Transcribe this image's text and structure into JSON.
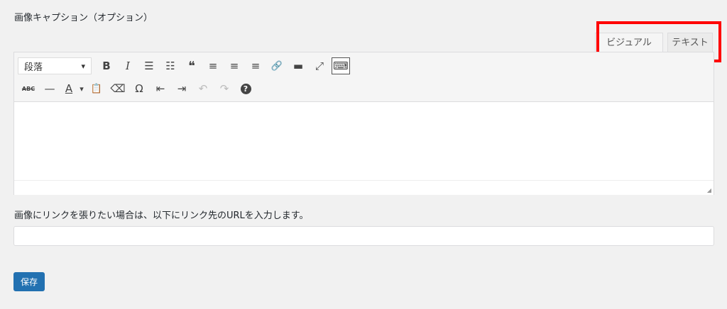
{
  "caption_label": "画像キャプション（オプション）",
  "tabs": {
    "visual": "ビジュアル",
    "text": "テキスト"
  },
  "toolbar": {
    "format_select": "段落",
    "row1_icons": [
      "bold-icon",
      "italic-icon",
      "bullet-list-icon",
      "numbered-list-icon",
      "blockquote-icon",
      "align-left-icon",
      "align-center-icon",
      "align-right-icon",
      "link-icon",
      "read-more-icon",
      "fullscreen-icon",
      "toolbar-toggle-icon"
    ],
    "row2_icons": [
      "strikethrough-icon",
      "horizontal-line-icon",
      "text-color-icon",
      "paste-text-icon",
      "clear-formatting-icon",
      "special-character-icon",
      "outdent-icon",
      "indent-icon",
      "undo-icon",
      "redo-icon",
      "help-icon"
    ],
    "glyphs": {
      "bold": "B",
      "italic": "I",
      "bullet": "☰",
      "numbered": "☷",
      "quote": "❝",
      "align_left": "≡",
      "align_center": "≡",
      "align_right": "≡",
      "link": "🔗",
      "more": "▬",
      "fullscreen": "⤢",
      "kitchen": "⌨",
      "strike": "ABC",
      "hr": "—",
      "color": "A",
      "paste": "📋",
      "eraser": "⌫",
      "omega": "Ω",
      "outdent": "⇤",
      "indent": "⇥",
      "undo": "↶",
      "redo": "↷",
      "help": "?",
      "dropdown": "▾",
      "resize": "◢"
    }
  },
  "link_label": "画像にリンクを張りたい場合は、以下にリンク先のURLを入力します。",
  "url_input": {
    "value": "",
    "placeholder": ""
  },
  "save_button": "保存",
  "colors": {
    "accent": "#2271b1",
    "highlight": "#ff0000"
  }
}
